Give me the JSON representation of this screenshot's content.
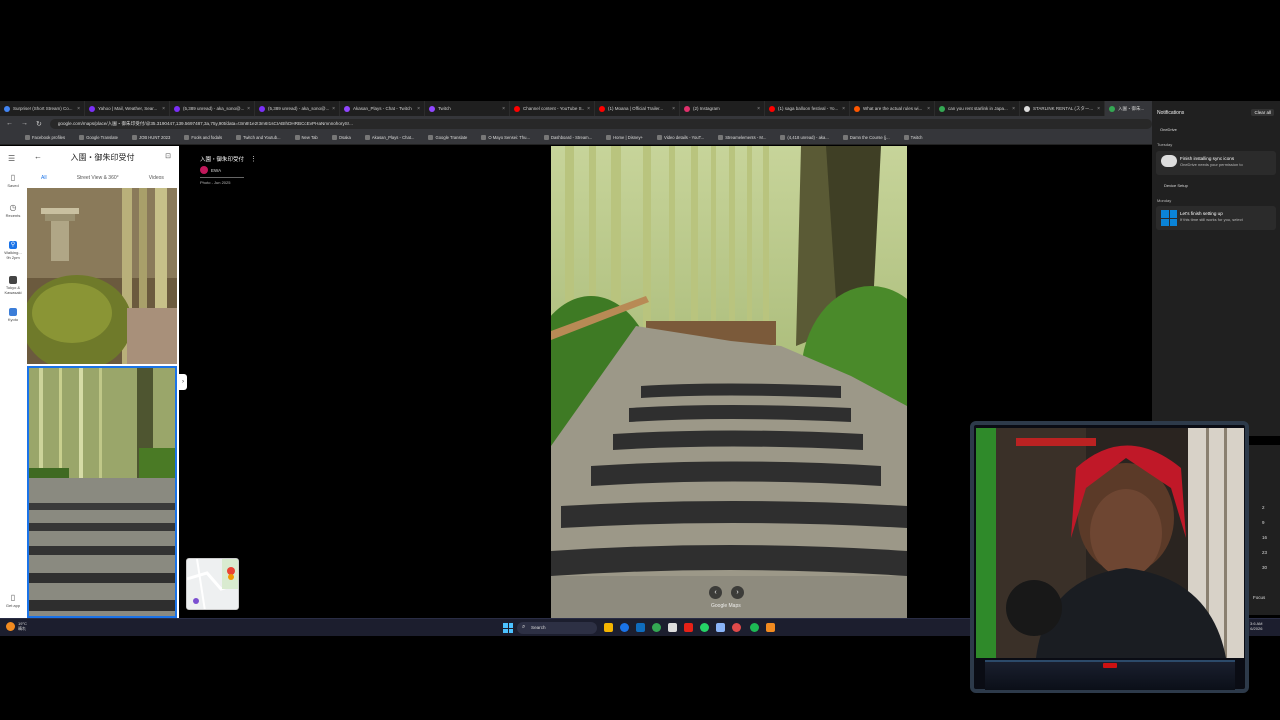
{
  "tabs": [
    {
      "label": "Surprise! (Short Stream) Co...",
      "color": "#4285f4"
    },
    {
      "label": "Yahoo | Mail, Weather, Sear...",
      "color": "#7b2ff7"
    },
    {
      "label": "(5,389 unread) - aka_sono@...",
      "color": "#7b2ff7"
    },
    {
      "label": "(5,389 unread) - aka_sono@...",
      "color": "#7b2ff7"
    },
    {
      "label": "Akasan_Plays - Chat - Twitch",
      "color": "#9146ff"
    },
    {
      "label": "Twitch",
      "color": "#9146ff"
    },
    {
      "label": "Channel content - YouTube S...",
      "color": "#ff0000"
    },
    {
      "label": "(1) Moana | Official Trailer...",
      "color": "#ff0000"
    },
    {
      "label": "(2) Instagram",
      "color": "#e1306c"
    },
    {
      "label": "(1) saga balloon festival - Yo...",
      "color": "#ff0000"
    },
    {
      "label": "What are the actual rules wi...",
      "color": "#ff5700"
    },
    {
      "label": "can you rent starlink in Japa...",
      "color": "#34a853"
    },
    {
      "label": "STARLINK RENTAL (スター...",
      "color": "#dddddd"
    },
    {
      "label": "入園・御朱...",
      "color": "#34a853"
    }
  ],
  "url": "google.com/maps/place/入園・御朱印受付/@35.3190447,139.5697487,3a,75y,90t/data=!3m8!1e2!3m6!1sCIABIhDHRBCcEvPHaNmnnohoryS!...",
  "bookmarks": [
    "Facebook profiles",
    "Google Translate",
    "JOB HUNT 2023",
    "Fools and fodals",
    "Twitch and Youtub...",
    "New Tab",
    "Osaka",
    "Akasan_Plays - Chat...",
    "Google Translate",
    "O Mayo Sensei: Thu...",
    "Dashboard - Stream...",
    "Home | Disney+",
    "Video details - YouT...",
    "Streamelements - M...",
    "(4,418 unread) - aka...",
    "Damn the Course (j...",
    "Twitch"
  ],
  "rail": [
    {
      "label": "Saved",
      "icon": "bookmark-icon"
    },
    {
      "label": "Recents",
      "icon": "history-icon"
    },
    {
      "label": "Walking... 9h 2pm",
      "icon": "walking-icon"
    },
    {
      "label": "Tokyo & Kawasaki",
      "icon": "map-icon"
    },
    {
      "label": "Kyoto",
      "icon": "map-icon"
    },
    {
      "label": "Get app",
      "icon": "phone-icon"
    }
  ],
  "panel": {
    "title": "入園・御朱印受付",
    "tabs": [
      "All",
      "Street View & 360°",
      "Videos"
    ]
  },
  "meta": {
    "title": "入園・御朱印受付",
    "user": "EWA",
    "date": "Photo - Jun 2025"
  },
  "viewer": {
    "watermark": "Google Maps"
  },
  "notifications": {
    "title": "Notifications",
    "clear_all": "Clear all",
    "app_onedrive": "OneDrive",
    "day1": "Tuesday",
    "card1_title": "Finish installing sync icons",
    "card1_body": "OneDrive needs your permission to",
    "app_device": "Device Setup",
    "day2": "Monday",
    "card2_title": "Let's finish setting up",
    "card2_body": "If this time still works for you, select"
  },
  "calendar_nums": [
    "2",
    "9",
    "16",
    "23",
    "30"
  ],
  "taskbar": {
    "weather_temp": "19°C",
    "weather_desc": "晴れ",
    "search": "Search",
    "time": "3:6 AM",
    "date": "6/2026",
    "focus": "Focus"
  }
}
